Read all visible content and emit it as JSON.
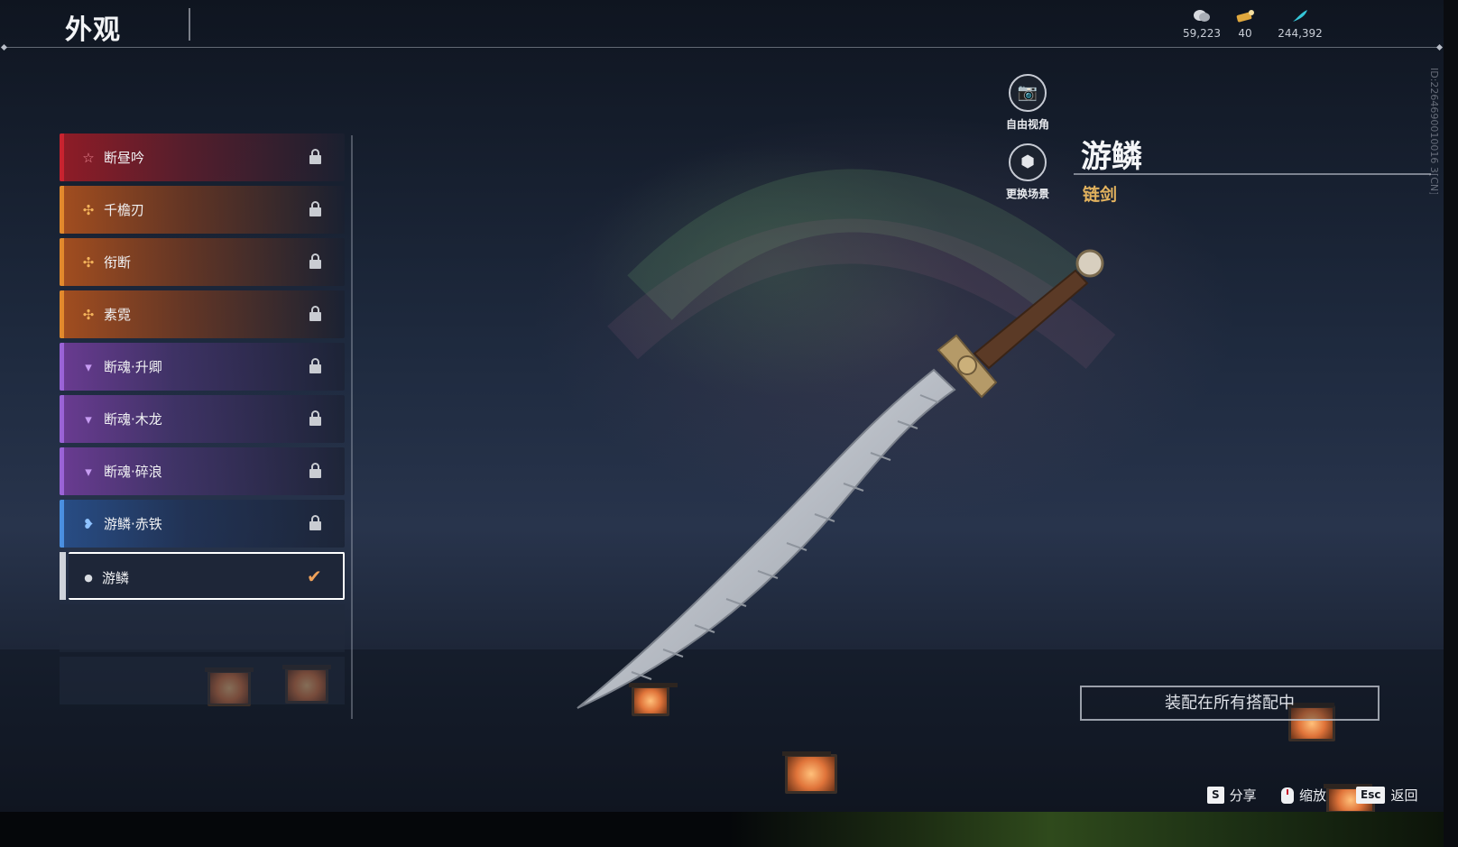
{
  "header": {
    "title": "外观"
  },
  "currencies": [
    {
      "icon": "coin-stack-icon",
      "value": "59,223"
    },
    {
      "icon": "gold-ticket-icon",
      "value": "40"
    },
    {
      "icon": "jade-feather-icon",
      "value": "244,392"
    }
  ],
  "id_text": "ID:2264690010016 3[CN]",
  "list": {
    "items": [
      {
        "label": "断昼吟",
        "rarity_color": "#c8232f",
        "icon": "star-icon",
        "locked": true
      },
      {
        "label": "千檐刃",
        "rarity_color": "#e2892c",
        "icon": "cross-petal-icon",
        "locked": true
      },
      {
        "label": "衔断",
        "rarity_color": "#e2892c",
        "icon": "cross-petal-icon",
        "locked": true
      },
      {
        "label": "素霓",
        "rarity_color": "#e2892c",
        "icon": "cross-petal-icon",
        "locked": true
      },
      {
        "label": "断魂·升卿",
        "rarity_color": "#9a63d6",
        "icon": "trefoil-icon",
        "locked": true
      },
      {
        "label": "断魂·木龙",
        "rarity_color": "#9a63d6",
        "icon": "trefoil-icon",
        "locked": true
      },
      {
        "label": "断魂·碎浪",
        "rarity_color": "#9a63d6",
        "icon": "trefoil-icon",
        "locked": true
      },
      {
        "label": "游鳞·赤铁",
        "rarity_color": "#4a8fe0",
        "icon": "wing-icon",
        "locked": true
      },
      {
        "label": "游鳞",
        "rarity_color": "#cfd3da",
        "icon": "drop-icon",
        "locked": false,
        "selected": true
      }
    ]
  },
  "camera": {
    "free_view_label": "自由视角",
    "change_scene_label": "更换场景"
  },
  "detail": {
    "name": "游鳞",
    "type": "链剑",
    "equip_label": "装配在所有搭配中"
  },
  "hints": {
    "share_key": "S",
    "share_label": "分享",
    "zoom_label": "缩放",
    "back_key": "Esc",
    "back_label": "返回"
  },
  "colors": {
    "accent_gold": "#e2b25e",
    "check_orange": "#f0a25a"
  }
}
